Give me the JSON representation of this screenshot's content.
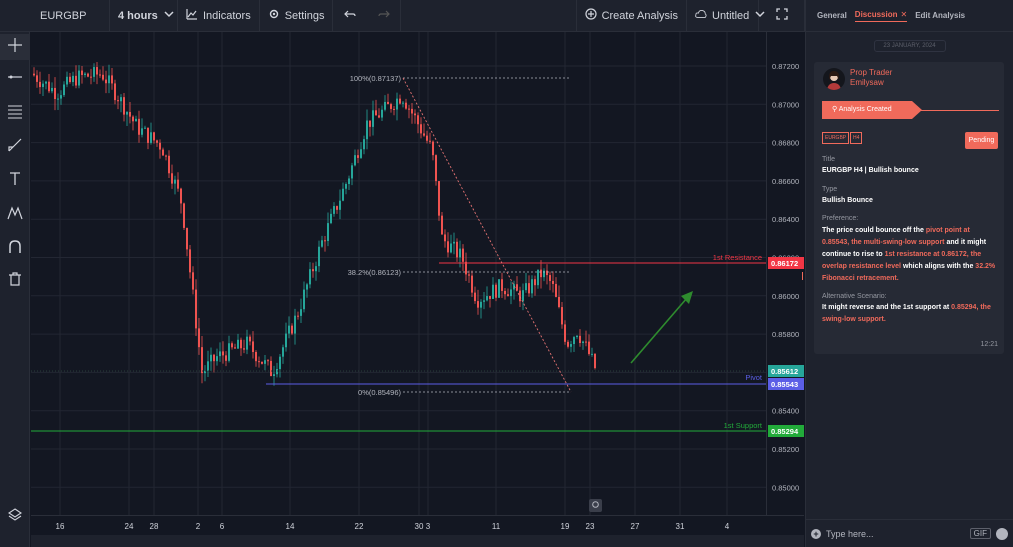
{
  "toolbar": {
    "symbol": "EURGBP",
    "interval": "4 hours",
    "indicators": "Indicators",
    "settings": "Settings",
    "create_analysis": "Create Analysis",
    "layout_name": "Untitled"
  },
  "panel": {
    "tabs": [
      "General",
      "Discussion",
      "Edit Analysis"
    ],
    "active_tab": "Discussion",
    "date": "23 JANUARY, 2024",
    "user_role": "Prop Trader",
    "user_name": "Emilysaw",
    "status_event": "Analysis Created",
    "chips": [
      "EURGBP",
      "H4"
    ],
    "status": "Pending",
    "title_label": "Title",
    "title_value": "EURGBP H4 | Bullish bounce",
    "type_label": "Type",
    "type_value": "Bullish Bounce",
    "preference_label": "Preference:",
    "preference_parts": [
      {
        "t": "The price could bounce off the ",
        "hl": false
      },
      {
        "t": "pivot point at 0.85543, the multi-swing-low support",
        "hl": true
      },
      {
        "t": " and it might continue to rise to ",
        "hl": false
      },
      {
        "t": "1st resistance at 0.86172, the overlap resistance level",
        "hl": true
      },
      {
        "t": " which aligns with the ",
        "hl": false
      },
      {
        "t": "32.2% Fibonacci retracement.",
        "hl": true
      }
    ],
    "alternative_label": "Alternative Scenario:",
    "alternative_parts": [
      {
        "t": "It might reverse and the 1st support at ",
        "hl": false
      },
      {
        "t": "0.85294, the swing-low support.",
        "hl": true
      }
    ],
    "time": "12:21",
    "input_placeholder": "Type here...",
    "gif_label": "GIF"
  },
  "chart": {
    "price_ticks": [
      "0.87200",
      "0.87000",
      "0.86800",
      "0.86600",
      "0.86400",
      "0.86200",
      "0.86000",
      "0.85800",
      "0.85600",
      "0.85400",
      "0.85200",
      "0.85000"
    ],
    "time_ticks": [
      "16",
      "24",
      "28",
      "2",
      "6",
      "14",
      "22",
      "30",
      "3",
      "11",
      "19",
      "23",
      "27",
      "31",
      "4"
    ],
    "levels": {
      "resistance": {
        "label": "1st Resistance",
        "price": "0.86172",
        "color": "#f23645"
      },
      "pivot": {
        "label": "Pivot",
        "price": "0.85543",
        "color": "#5b5ee6"
      },
      "support": {
        "label": "1st Support",
        "price": "0.85294",
        "color": "#22ab3a"
      },
      "current": {
        "price": "0.85612",
        "color": "#26a69a"
      }
    },
    "fib": [
      {
        "label": "100%(0.87137)"
      },
      {
        "label": "38.2%(0.86123)"
      },
      {
        "label": "0%(0.85496)"
      }
    ]
  }
}
